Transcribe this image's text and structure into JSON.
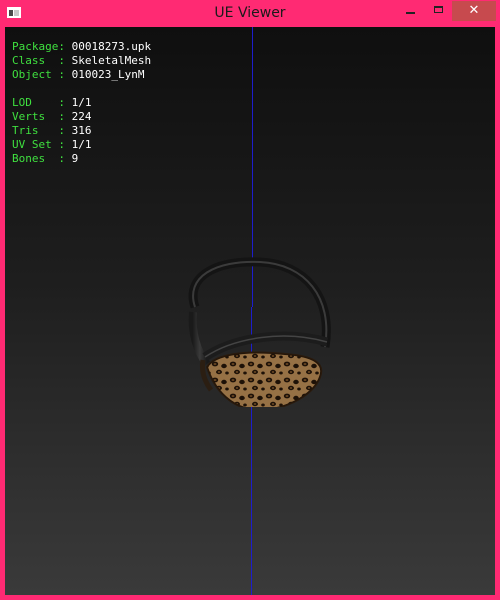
{
  "window": {
    "title": "UE Viewer",
    "icon": "app-window-icon",
    "close_glyph": "✕",
    "accent": "#ff2a73",
    "close_bg": "#c74a4e"
  },
  "info": {
    "rows_top": [
      {
        "key": "Package: ",
        "value": "00018273.upk"
      },
      {
        "key": "Class  : ",
        "value": "SkeletalMesh"
      },
      {
        "key": "Object : ",
        "value": "010023_LynM"
      }
    ],
    "rows_bottom": [
      {
        "key": "LOD    : ",
        "value": "1/1"
      },
      {
        "key": "Verts  : ",
        "value": "224"
      },
      {
        "key": "Tris   : ",
        "value": "316"
      },
      {
        "key": "UV Set : ",
        "value": "1/1"
      },
      {
        "key": "Bones  : ",
        "value": "9"
      }
    ],
    "key_color": "#3fe03f",
    "value_color": "#ffffff"
  },
  "viewport": {
    "axis_color": "#1d1dcc"
  }
}
